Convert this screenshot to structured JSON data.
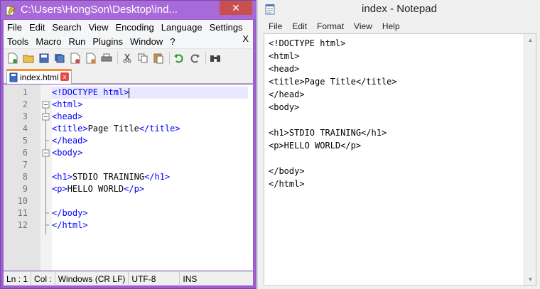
{
  "npp": {
    "title": "C:\\Users\\HongSon\\Desktop\\ind...",
    "close": "✕",
    "menu_row1": [
      "File",
      "Edit",
      "Search",
      "View",
      "Encoding",
      "Language",
      "Settings"
    ],
    "menu_row2": [
      "Tools",
      "Macro",
      "Run",
      "Plugins",
      "Window",
      "?"
    ],
    "menu_close": "X",
    "tab": {
      "label": "index.html",
      "close": "x"
    },
    "line_numbers": [
      "1",
      "2",
      "3",
      "4",
      "5",
      "6",
      "7",
      "8",
      "9",
      "10",
      "11",
      "12"
    ],
    "lines": [
      {
        "tag1": "<!DOCTYPE html>",
        "text": "",
        "tag2": ""
      },
      {
        "tag1": "<html>",
        "text": "",
        "tag2": ""
      },
      {
        "tag1": "<head>",
        "text": "",
        "tag2": ""
      },
      {
        "tag1": "<title>",
        "text": "Page Title",
        "tag2": "</title>"
      },
      {
        "tag1": "</head>",
        "text": "",
        "tag2": ""
      },
      {
        "tag1": "<body>",
        "text": "",
        "tag2": ""
      },
      {
        "tag1": "",
        "text": "",
        "tag2": ""
      },
      {
        "tag1": "<h1>",
        "text": "STDIO TRAINING",
        "tag2": "</h1>"
      },
      {
        "tag1": "<p>",
        "text": "HELLO WORLD",
        "tag2": "</p>"
      },
      {
        "tag1": "",
        "text": "",
        "tag2": ""
      },
      {
        "tag1": "</body>",
        "text": "",
        "tag2": ""
      },
      {
        "tag1": "</html>",
        "text": "",
        "tag2": ""
      }
    ],
    "status": {
      "ln": "Ln : 1",
      "col": "Col :",
      "eol": "Windows (CR LF)",
      "encoding": "UTF-8",
      "mode": "INS"
    }
  },
  "notepad": {
    "title": "index - Notepad",
    "menu": [
      "File",
      "Edit",
      "Format",
      "View",
      "Help"
    ],
    "content": "<!DOCTYPE html>\n<html>\n<head>\n<title>Page Title</title>\n</head>\n<body>\n\n<h1>STDIO TRAINING</h1>\n<p>HELLO WORLD</p>\n\n</body>\n</html>"
  },
  "colors": {
    "npp_frame": "#9d5fcf",
    "close_red": "#c7504f",
    "tag_blue": "#0000ff",
    "tab_accent": "#fa8e2d"
  }
}
